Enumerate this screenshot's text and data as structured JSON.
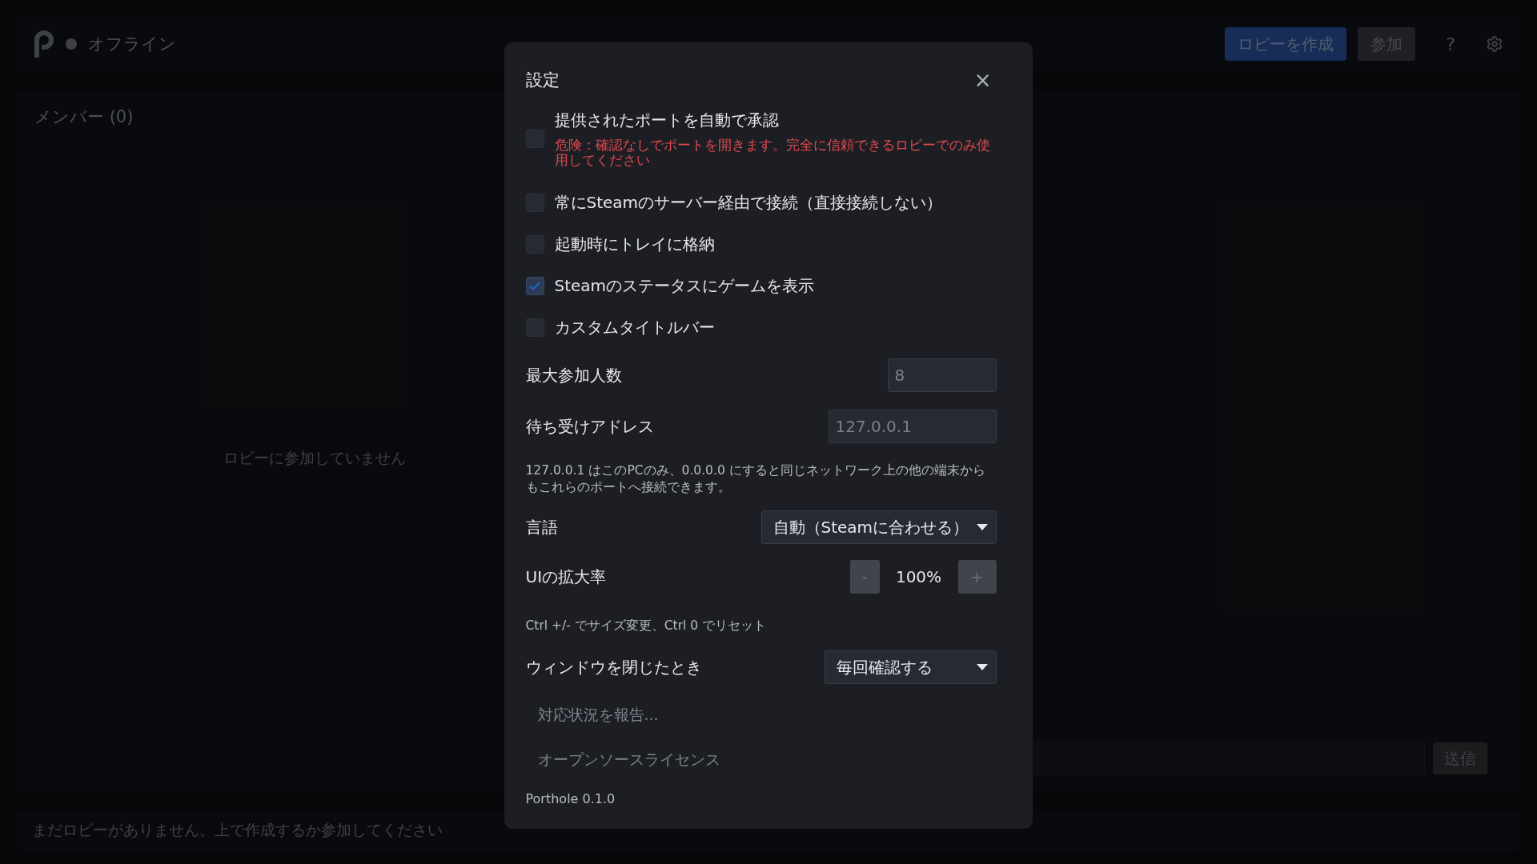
{
  "header": {
    "status": "オフライン",
    "buttons": [
      {
        "label": "ロビーを作成",
        "kind": "primary"
      },
      {
        "label": "参加",
        "kind": "secondary"
      }
    ],
    "help": "?"
  },
  "members": {
    "title": "メンバー (0)",
    "empty": "ロビーに参加していません"
  },
  "chat": {
    "send": "送信"
  },
  "status_bar": "まだロビーがありません。上で作成するか参加してください",
  "settings": {
    "title": "設定",
    "close": "×",
    "options": [
      {
        "label": "提供されたポートを自動で承認",
        "checked": false,
        "warning": "危険：確認なしでポートを開きます。完全に信頼できるロビーでのみ使用してください"
      },
      {
        "label": "常にSteamのサーバー経由で接続（直接接続しない）",
        "checked": false
      },
      {
        "label": "起動時にトレイに格納",
        "checked": false
      },
      {
        "label": "Steamのステータスにゲームを表示",
        "checked": true
      },
      {
        "label": "カスタムタイトルバー",
        "checked": false
      }
    ],
    "max_players": {
      "label": "最大参加人数",
      "placeholder": "8"
    },
    "address": {
      "label": "待ち受けアドレス",
      "placeholder": "127.0.0.1",
      "hint": "127.0.0.1 はこのPCのみ、0.0.0.0 にすると同じネットワーク上の他の端末からもこれらのポートへ接続できます。"
    },
    "language": {
      "label": "言語",
      "value": "自動（Steamに合わせる）"
    },
    "zoom": {
      "label": "UIの拡大率",
      "minus": "-",
      "value": "100%",
      "plus": "+",
      "hint": "Ctrl +/- でサイズ変更、Ctrl 0 でリセット"
    },
    "close_action": {
      "label": "ウィンドウを閉じたとき",
      "value": "毎回確認する"
    },
    "links": [
      "対応状況を報告...",
      "オープンソースライセンス"
    ],
    "version": "Porthole 0.1.0"
  }
}
